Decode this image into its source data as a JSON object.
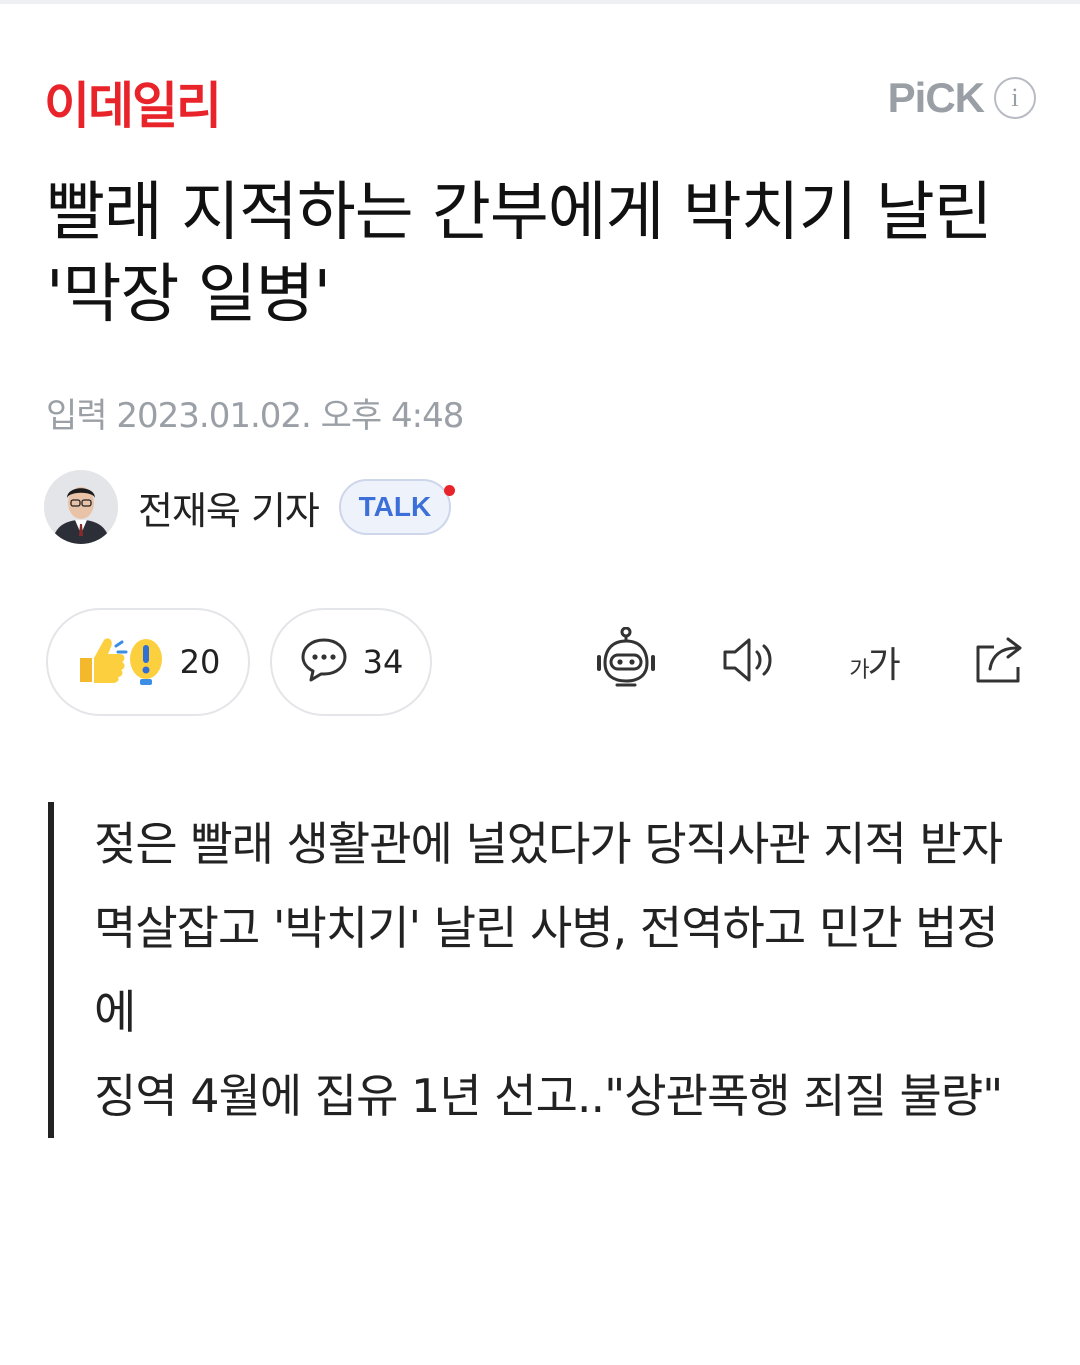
{
  "header": {
    "brand": "이데일리",
    "brand_color": "#e8242a",
    "pick_label": "PiCK",
    "info_icon": "info-icon"
  },
  "article": {
    "headline": "빨래 지적하는 간부에게 박치기 날린 '막장 일병'",
    "dateline": "입력 2023.01.02. 오후 4:48",
    "reporter": {
      "name": "전재욱 기자",
      "talk_label": "TALK"
    },
    "reactions": {
      "like_icon": "thumbs-up-icon",
      "like_count": "20",
      "comment_icon": "speech-bubble-icon",
      "comment_count": "34"
    },
    "tools": {
      "summary_bot": "robot-icon",
      "tts": "speaker-icon",
      "font_size_label": "가가",
      "share": "share-icon"
    },
    "summary_lines": [
      "젖은 빨래 생활관에 널었다가 당직사관 지적 받자",
      "멱살잡고 '박치기' 날린 사병, 전역하고 민간 법정에",
      "징역 4월에 집유 1년 선고..\"상관폭행 죄질 불량\""
    ]
  }
}
